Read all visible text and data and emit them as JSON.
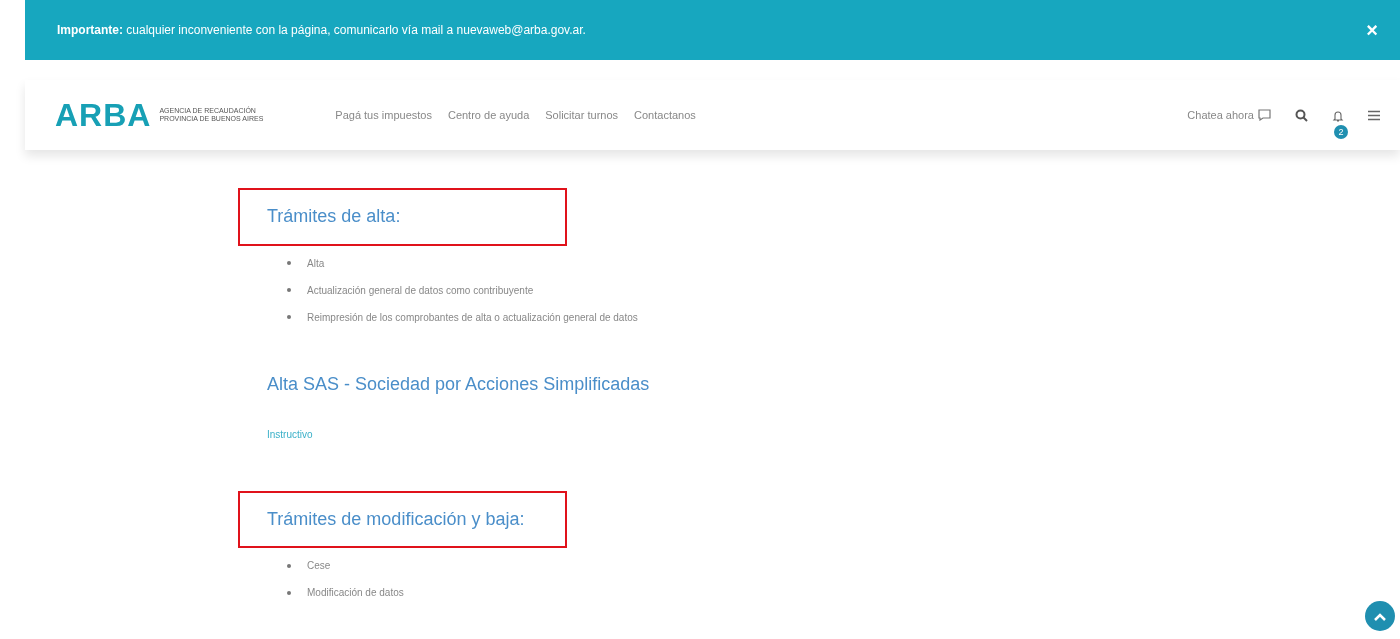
{
  "alert": {
    "label": "Importante:",
    "text": "cualquier inconveniente con la página, comunicarlo vía mail a nuevaweb@arba.gov.ar.",
    "close": "×"
  },
  "navbar": {
    "logo": "ARBA",
    "agency": [
      "AGENCIA DE RECAUDACIÓN",
      "PROVINCIA DE BUENOS AIRES"
    ],
    "links": [
      "Pagá tus impuestos",
      "Centro de ayuda",
      "Solicitar turnos",
      "Contactanos"
    ],
    "chat": "Chatea ahora",
    "notifications": "2"
  },
  "sections": [
    {
      "title": "Trámites de alta:",
      "highlighted": true,
      "items": [
        "Alta",
        "Actualización general de datos como contribuyente",
        "Reimpresión de los comprobantes de alta o actualización general de datos"
      ]
    },
    {
      "title": "Alta SAS - Sociedad por Acciones Simplificadas",
      "highlighted": false,
      "link": "Instructivo"
    },
    {
      "title": "Trámites de modificación y baja:",
      "highlighted": true,
      "items": [
        "Cese",
        "Modificación de datos"
      ]
    }
  ]
}
